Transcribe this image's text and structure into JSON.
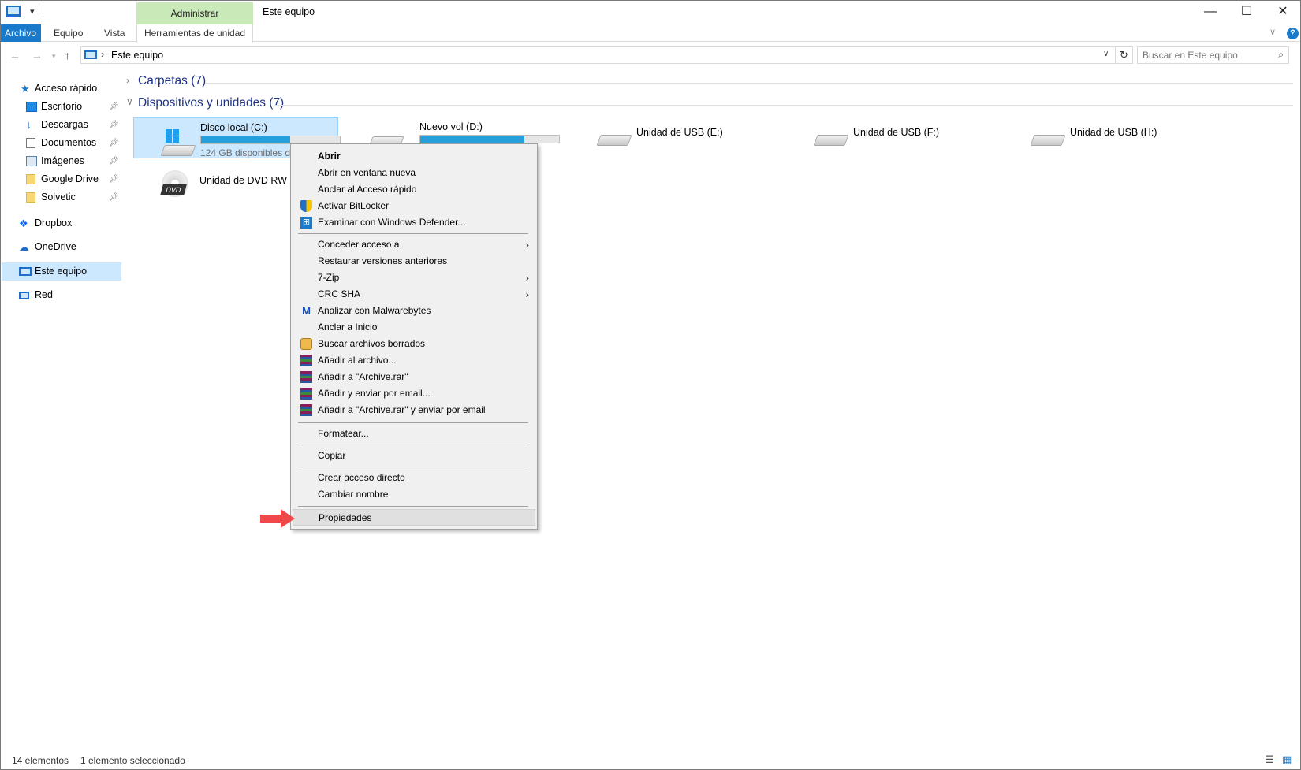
{
  "window": {
    "title": "Este equipo",
    "contextual_tab_group": "Administrar",
    "minimize": "—",
    "maximize": "☐",
    "close": "✕"
  },
  "ribbon": {
    "tabs": [
      "Archivo",
      "Equipo",
      "Vista",
      "Herramientas de unidad"
    ],
    "help": "?"
  },
  "address": {
    "path": "Este equipo",
    "search_placeholder": "Buscar en Este equipo"
  },
  "sidebar": {
    "items": [
      {
        "label": "Acceso rápido",
        "icon": "star-icon",
        "pinned": false
      },
      {
        "label": "Escritorio",
        "icon": "desktop-icon",
        "pinned": true
      },
      {
        "label": "Descargas",
        "icon": "download-icon",
        "pinned": true
      },
      {
        "label": "Documentos",
        "icon": "documents-icon",
        "pinned": true
      },
      {
        "label": "Imágenes",
        "icon": "images-icon",
        "pinned": true
      },
      {
        "label": "Google Drive",
        "icon": "folder-icon",
        "pinned": true
      },
      {
        "label": "Solvetic",
        "icon": "folder-icon",
        "pinned": true
      },
      {
        "label": "Dropbox",
        "icon": "dropbox-icon",
        "pinned": false
      },
      {
        "label": "OneDrive",
        "icon": "cloud-icon",
        "pinned": false
      },
      {
        "label": "Este equipo",
        "icon": "computer-icon",
        "pinned": false,
        "selected": true
      },
      {
        "label": "Red",
        "icon": "network-icon",
        "pinned": false
      }
    ]
  },
  "main": {
    "groups": [
      {
        "label": "Carpetas (7)",
        "expanded": false
      },
      {
        "label": "Dispositivos y unidades (7)",
        "expanded": true
      }
    ],
    "drives": [
      {
        "name": "Disco local (C:)",
        "free": "124 GB disponibles de",
        "usage_fraction": 0.64,
        "selected": true
      },
      {
        "name": "Nuevo vol (D:)",
        "usage_fraction": 0.75
      },
      {
        "name": "Unidad de USB (E:)"
      },
      {
        "name": "Unidad de USB (F:)"
      },
      {
        "name": "Unidad de USB (H:)"
      },
      {
        "name": "Unidad de DVD RW (I:",
        "badge": "DVD"
      }
    ]
  },
  "context_menu": {
    "items": [
      {
        "label": "Abrir",
        "bold": true
      },
      {
        "label": "Abrir en ventana nueva"
      },
      {
        "label": "Anclar al Acceso rápido"
      },
      {
        "label": "Activar BitLocker",
        "icon": "shield-icon"
      },
      {
        "label": "Examinar con Windows Defender...",
        "icon": "defender-icon"
      },
      {
        "label": "Conceder acceso a",
        "submenu": true
      },
      {
        "label": "Restaurar versiones anteriores"
      },
      {
        "label": "7-Zip",
        "submenu": true
      },
      {
        "label": "CRC SHA",
        "submenu": true
      },
      {
        "label": "Analizar con Malwarebytes",
        "icon": "malwarebytes-icon"
      },
      {
        "label": "Anclar a Inicio"
      },
      {
        "label": "Buscar archivos borrados",
        "icon": "recovery-icon"
      },
      {
        "label": "Añadir al archivo...",
        "icon": "winrar-icon"
      },
      {
        "label": "Añadir a \"Archive.rar\"",
        "icon": "winrar-icon"
      },
      {
        "label": "Añadir y enviar por email...",
        "icon": "winrar-icon"
      },
      {
        "label": "Añadir a \"Archive.rar\" y enviar por email",
        "icon": "winrar-icon"
      },
      {
        "label": "Formatear..."
      },
      {
        "label": "Copiar"
      },
      {
        "label": "Crear acceso directo"
      },
      {
        "label": "Cambiar nombre"
      },
      {
        "label": "Propiedades",
        "highlighted": true
      }
    ]
  },
  "status": {
    "count": "14 elementos",
    "selection": "1 elemento seleccionado"
  },
  "colors": {
    "accent": "#1979ca",
    "selection": "#cce8ff",
    "drive_bar": "#26a0da",
    "contextual_tab": "#c9e9b8",
    "arrow": "#f0484a"
  }
}
